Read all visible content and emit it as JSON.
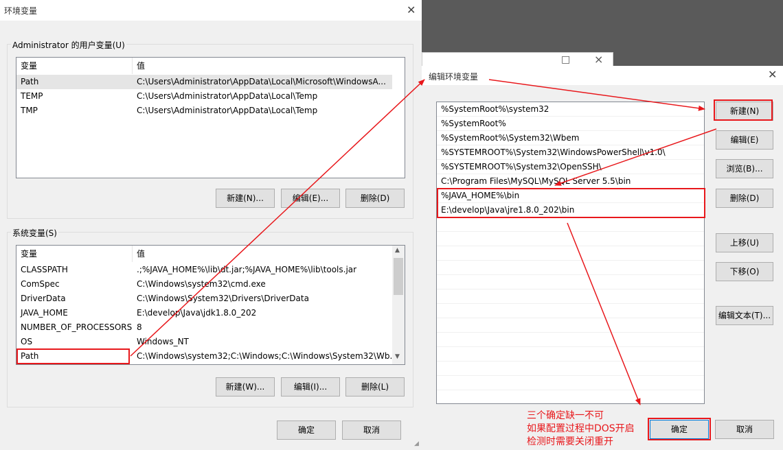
{
  "left_dialog": {
    "title": "环境变量",
    "user_group_label": "Administrator 的用户变量(U)",
    "user_table": {
      "headers": [
        "变量",
        "值"
      ],
      "rows": [
        {
          "name": "Path",
          "value": "C:\\Users\\Administrator\\AppData\\Local\\Microsoft\\WindowsA..."
        },
        {
          "name": "TEMP",
          "value": "C:\\Users\\Administrator\\AppData\\Local\\Temp"
        },
        {
          "name": "TMP",
          "value": "C:\\Users\\Administrator\\AppData\\Local\\Temp"
        }
      ]
    },
    "user_buttons": {
      "new": "新建(N)...",
      "edit": "编辑(E)...",
      "delete": "删除(D)"
    },
    "system_group_label": "系统变量(S)",
    "system_table": {
      "headers": [
        "变量",
        "值"
      ],
      "rows": [
        {
          "name": "CLASSPATH",
          "value": ".;%JAVA_HOME%\\lib\\dt.jar;%JAVA_HOME%\\lib\\tools.jar"
        },
        {
          "name": "ComSpec",
          "value": "C:\\Windows\\system32\\cmd.exe"
        },
        {
          "name": "DriverData",
          "value": "C:\\Windows\\System32\\Drivers\\DriverData"
        },
        {
          "name": "JAVA_HOME",
          "value": "E:\\develop\\Java\\jdk1.8.0_202"
        },
        {
          "name": "NUMBER_OF_PROCESSORS",
          "value": "8"
        },
        {
          "name": "OS",
          "value": "Windows_NT"
        },
        {
          "name": "Path",
          "value": "C:\\Windows\\system32;C:\\Windows;C:\\Windows\\System32\\Wb..."
        }
      ]
    },
    "system_buttons": {
      "new": "新建(W)...",
      "edit": "编辑(I)...",
      "delete": "删除(L)"
    },
    "ok": "确定",
    "cancel": "取消"
  },
  "right_dialog": {
    "title": "编辑环境变量",
    "paths": [
      "%SystemRoot%\\system32",
      "%SystemRoot%",
      "%SystemRoot%\\System32\\Wbem",
      "%SYSTEMROOT%\\System32\\WindowsPowerShell\\v1.0\\",
      "%SYSTEMROOT%\\System32\\OpenSSH\\",
      "C:\\Program Files\\MySQL\\MySQL Server 5.5\\bin",
      "%JAVA_HOME%\\bin",
      "E:\\develop\\Java\\jre1.8.0_202\\bin"
    ],
    "buttons": {
      "new": "新建(N)",
      "edit": "编辑(E)",
      "browse": "浏览(B)...",
      "delete": "删除(D)",
      "move_up": "上移(U)",
      "move_down": "下移(O)",
      "edit_text": "编辑文本(T)..."
    },
    "ok": "确定",
    "cancel": "取消"
  },
  "annotation": {
    "line1": "三个确定缺一不可",
    "line2": "如果配置过程中DOS开启",
    "line3": "检测时需要关闭重开",
    "color": "#e8171b"
  },
  "behind_window_controls": [
    "□",
    "×"
  ]
}
